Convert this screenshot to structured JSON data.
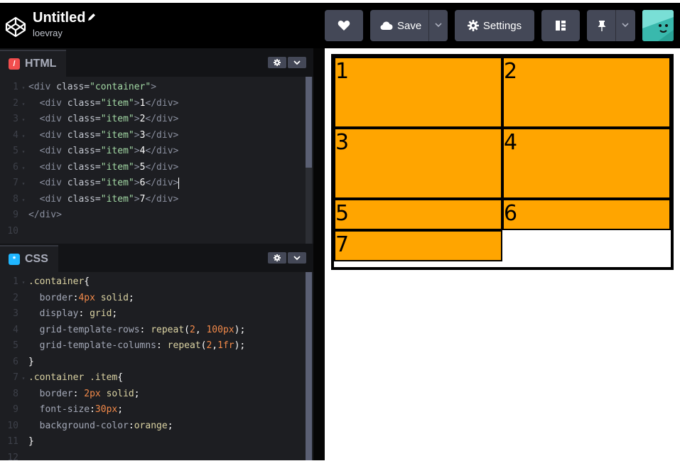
{
  "header": {
    "title": "Untitled",
    "user": "loevray",
    "save_label": "Save",
    "settings_label": "Settings"
  },
  "html_pane": {
    "label": "HTML",
    "lines": [
      {
        "n": "1",
        "parts": [
          [
            "tag",
            "<div "
          ],
          [
            "attr",
            "class="
          ],
          [
            "str",
            "\"container\""
          ],
          [
            "tag",
            ">"
          ]
        ]
      },
      {
        "n": "2",
        "parts": [
          [
            "tag",
            "  <div "
          ],
          [
            "attr",
            "class="
          ],
          [
            "str",
            "\"item\""
          ],
          [
            "tag",
            ">"
          ],
          [
            "txt",
            "1"
          ],
          [
            "tag",
            "</div>"
          ]
        ]
      },
      {
        "n": "3",
        "parts": [
          [
            "tag",
            "  <div "
          ],
          [
            "attr",
            "class="
          ],
          [
            "str",
            "\"item\""
          ],
          [
            "tag",
            ">"
          ],
          [
            "txt",
            "2"
          ],
          [
            "tag",
            "</div>"
          ]
        ]
      },
      {
        "n": "4",
        "parts": [
          [
            "tag",
            "  <div "
          ],
          [
            "attr",
            "class="
          ],
          [
            "str",
            "\"item\""
          ],
          [
            "tag",
            ">"
          ],
          [
            "txt",
            "3"
          ],
          [
            "tag",
            "</div>"
          ]
        ]
      },
      {
        "n": "5",
        "parts": [
          [
            "tag",
            "  <div "
          ],
          [
            "attr",
            "class="
          ],
          [
            "str",
            "\"item\""
          ],
          [
            "tag",
            ">"
          ],
          [
            "txt",
            "4"
          ],
          [
            "tag",
            "</div>"
          ]
        ]
      },
      {
        "n": "6",
        "parts": [
          [
            "tag",
            "  <div "
          ],
          [
            "attr",
            "class="
          ],
          [
            "str",
            "\"item\""
          ],
          [
            "tag",
            ">"
          ],
          [
            "txt",
            "5"
          ],
          [
            "tag",
            "</div>"
          ]
        ]
      },
      {
        "n": "7",
        "parts": [
          [
            "tag",
            "  <div "
          ],
          [
            "attr",
            "class="
          ],
          [
            "str",
            "\"item\""
          ],
          [
            "tag",
            ">"
          ],
          [
            "txt",
            "6"
          ],
          [
            "tag",
            "</div>"
          ]
        ],
        "cursor": true
      },
      {
        "n": "8",
        "parts": [
          [
            "tag",
            "  <div "
          ],
          [
            "attr",
            "class="
          ],
          [
            "str",
            "\"item\""
          ],
          [
            "tag",
            ">"
          ],
          [
            "txt",
            "7"
          ],
          [
            "tag",
            "</div>"
          ]
        ]
      },
      {
        "n": "9",
        "parts": [
          [
            "tag",
            "</div>"
          ]
        ]
      },
      {
        "n": "10",
        "parts": []
      }
    ]
  },
  "css_pane": {
    "label": "CSS",
    "lines": [
      {
        "n": "1",
        "parts": [
          [
            "sel",
            ".container"
          ],
          [
            "p",
            "{"
          ]
        ]
      },
      {
        "n": "2",
        "parts": [
          [
            "prop",
            "  border"
          ],
          [
            "p",
            ":"
          ],
          [
            "num",
            "4px"
          ],
          [
            "kw",
            " solid"
          ],
          [
            "p",
            ";"
          ]
        ]
      },
      {
        "n": "3",
        "parts": [
          [
            "prop",
            "  display"
          ],
          [
            "p",
            ": "
          ],
          [
            "kw",
            "grid"
          ],
          [
            "p",
            ";"
          ]
        ]
      },
      {
        "n": "4",
        "parts": [
          [
            "prop",
            "  grid-template-rows"
          ],
          [
            "p",
            ": "
          ],
          [
            "kw",
            "repeat"
          ],
          [
            "p",
            "("
          ],
          [
            "num",
            "2"
          ],
          [
            "p",
            ", "
          ],
          [
            "num",
            "100px"
          ],
          [
            "p",
            ");"
          ]
        ]
      },
      {
        "n": "5",
        "parts": [
          [
            "prop",
            "  grid-template-columns"
          ],
          [
            "p",
            ": "
          ],
          [
            "kw",
            "repeat"
          ],
          [
            "p",
            "("
          ],
          [
            "num",
            "2"
          ],
          [
            "p",
            ","
          ],
          [
            "num",
            "1fr"
          ],
          [
            "p",
            ");"
          ]
        ]
      },
      {
        "n": "6",
        "parts": [
          [
            "p",
            "}"
          ]
        ]
      },
      {
        "n": "7",
        "parts": [
          [
            "sel",
            ".container .item"
          ],
          [
            "p",
            "{"
          ]
        ]
      },
      {
        "n": "8",
        "parts": [
          [
            "prop",
            "  border"
          ],
          [
            "p",
            ": "
          ],
          [
            "num",
            "2px"
          ],
          [
            "kw",
            " solid"
          ],
          [
            "p",
            ";"
          ]
        ]
      },
      {
        "n": "9",
        "parts": [
          [
            "prop",
            "  font-size"
          ],
          [
            "p",
            ":"
          ],
          [
            "num",
            "30px"
          ],
          [
            "p",
            ";"
          ]
        ]
      },
      {
        "n": "10",
        "parts": [
          [
            "prop",
            "  background-color"
          ],
          [
            "p",
            ":"
          ],
          [
            "kw",
            "orange"
          ],
          [
            "p",
            ";"
          ]
        ]
      },
      {
        "n": "11",
        "parts": [
          [
            "p",
            "}"
          ]
        ]
      },
      {
        "n": "12",
        "parts": []
      }
    ]
  },
  "preview": {
    "items": [
      "1",
      "2",
      "3",
      "4",
      "5",
      "6",
      "7"
    ]
  },
  "colors": {
    "item_background": "#ffa500",
    "html_icon": "#f24e4e",
    "css_icon": "#1fb6ff"
  }
}
